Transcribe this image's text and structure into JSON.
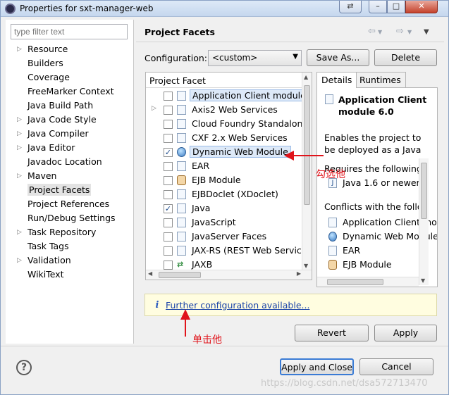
{
  "window": {
    "title": "Properties for sxt-manager-web"
  },
  "filter": {
    "placeholder": "type filter text"
  },
  "nav": {
    "items": [
      {
        "label": "Resource",
        "expandable": true
      },
      {
        "label": "Builders",
        "expandable": false
      },
      {
        "label": "Coverage",
        "expandable": false
      },
      {
        "label": "FreeMarker Context",
        "expandable": false
      },
      {
        "label": "Java Build Path",
        "expandable": false
      },
      {
        "label": "Java Code Style",
        "expandable": true
      },
      {
        "label": "Java Compiler",
        "expandable": true
      },
      {
        "label": "Java Editor",
        "expandable": true
      },
      {
        "label": "Javadoc Location",
        "expandable": false
      },
      {
        "label": "Maven",
        "expandable": true
      },
      {
        "label": "Project Facets",
        "expandable": false,
        "selected": true
      },
      {
        "label": "Project References",
        "expandable": false
      },
      {
        "label": "Run/Debug Settings",
        "expandable": false
      },
      {
        "label": "Task Repository",
        "expandable": true
      },
      {
        "label": "Task Tags",
        "expandable": false
      },
      {
        "label": "Validation",
        "expandable": true
      },
      {
        "label": "WikiText",
        "expandable": false
      }
    ]
  },
  "main": {
    "title": "Project Facets",
    "config_label": "Configuration:",
    "config_value": "<custom>",
    "save_as": "Save As...",
    "delete": "Delete",
    "facet_header": "Project Facet",
    "facets": [
      {
        "label": "Application Client module",
        "checked": false,
        "icon": "doc",
        "highlight": true
      },
      {
        "label": "Axis2 Web Services",
        "checked": false,
        "icon": "doc",
        "expandable": true
      },
      {
        "label": "Cloud Foundry Standalone",
        "checked": false,
        "icon": "doc"
      },
      {
        "label": "CXF 2.x Web Services",
        "checked": false,
        "icon": "doc"
      },
      {
        "label": "Dynamic Web Module",
        "checked": true,
        "icon": "globe",
        "highlight": true
      },
      {
        "label": "EAR",
        "checked": false,
        "icon": "doc"
      },
      {
        "label": "EJB Module",
        "checked": false,
        "icon": "jar"
      },
      {
        "label": "EJBDoclet (XDoclet)",
        "checked": false,
        "icon": "doc"
      },
      {
        "label": "Java",
        "checked": true,
        "icon": "doc"
      },
      {
        "label": "JavaScript",
        "checked": false,
        "icon": "doc"
      },
      {
        "label": "JavaServer Faces",
        "checked": false,
        "icon": "doc"
      },
      {
        "label": "JAX-RS (REST Web Services)",
        "checked": false,
        "icon": "doc"
      },
      {
        "label": "JAXB",
        "checked": false,
        "icon": "jx"
      }
    ],
    "details": {
      "tabs": [
        "Details",
        "Runtimes"
      ],
      "title": "Application Client module 6.0",
      "description": "Enables the project to be deployed as a Java EE Application Client module.",
      "requires_label": "Requires the following facet:",
      "requires": [
        {
          "label": "Java 1.6 or newer",
          "icon": "java"
        }
      ],
      "conflicts_label": "Conflicts with the following facets:",
      "conflicts": [
        {
          "label": "Application Client module",
          "icon": "doc"
        },
        {
          "label": "Dynamic Web Module",
          "icon": "globe"
        },
        {
          "label": "EAR",
          "icon": "doc"
        },
        {
          "label": "EJB Module",
          "icon": "jar"
        }
      ]
    },
    "info_link": "Further configuration available...",
    "revert": "Revert",
    "apply": "Apply"
  },
  "annotations": {
    "check_it": "勾选他",
    "click_it": "单击他"
  },
  "footer": {
    "apply_close": "Apply and Close",
    "cancel": "Cancel",
    "watermark": "https://blog.csdn.net/dsa572713470"
  },
  "colors": {
    "annotation": "#e0141b",
    "link": "#1b44a8",
    "accent": "#3a7bd5"
  }
}
